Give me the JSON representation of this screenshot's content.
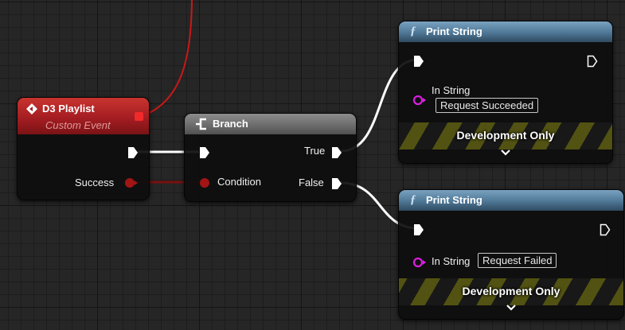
{
  "custom_event": {
    "title": "D3 Playlist",
    "subtitle": "Custom Event",
    "output_pin_label": "Success"
  },
  "branch": {
    "title": "Branch",
    "condition_label": "Condition",
    "true_label": "True",
    "false_label": "False"
  },
  "print_success": {
    "title": "Print String",
    "in_string_label": "In String",
    "in_string_value": "Request Succeeded",
    "dev_only_label": "Development Only"
  },
  "print_failed": {
    "title": "Print String",
    "in_string_label": "In String",
    "in_string_value": "Request Failed",
    "dev_only_label": "Development Only"
  },
  "colors": {
    "event_header": "#b8242a",
    "function_header": "#5a85a6",
    "branch_header": "#6f6f6f",
    "exec_wire": "#ffffff",
    "bool_wire": "#8e1515",
    "string_pin": "#d91ee0"
  }
}
